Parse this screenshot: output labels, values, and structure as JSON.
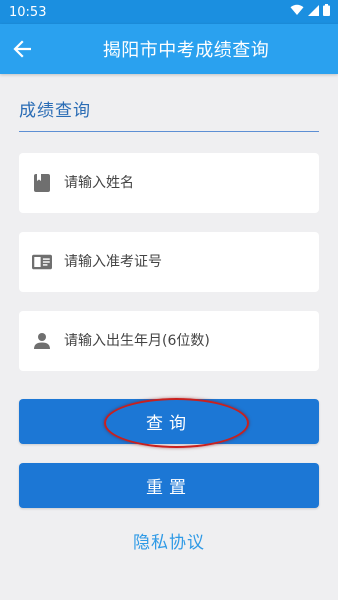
{
  "status_bar": {
    "time": "10:53",
    "icons": [
      "wifi-icon",
      "cell-signal-icon",
      "battery-icon"
    ]
  },
  "app_bar": {
    "back_icon": "arrow-left-icon",
    "title": "揭阳市中考成绩查询"
  },
  "form": {
    "section_title": "成绩查询",
    "fields": [
      {
        "icon": "book-icon",
        "placeholder": "请输入姓名",
        "value": ""
      },
      {
        "icon": "id-card-icon",
        "placeholder": "请输入准考证号",
        "value": ""
      },
      {
        "icon": "person-icon",
        "placeholder": "请输入出生年月(6位数)",
        "value": ""
      }
    ],
    "query_button": "查询",
    "reset_button": "重置",
    "privacy_link": "隐私协议"
  },
  "colors": {
    "status_bar": "#1b8fe0",
    "app_bar": "#2aa1ef",
    "button": "#1c77d5",
    "link": "#2f9ae6",
    "section_title": "#2a6cb5",
    "highlight": "#c8201e",
    "background": "#efeff1"
  }
}
